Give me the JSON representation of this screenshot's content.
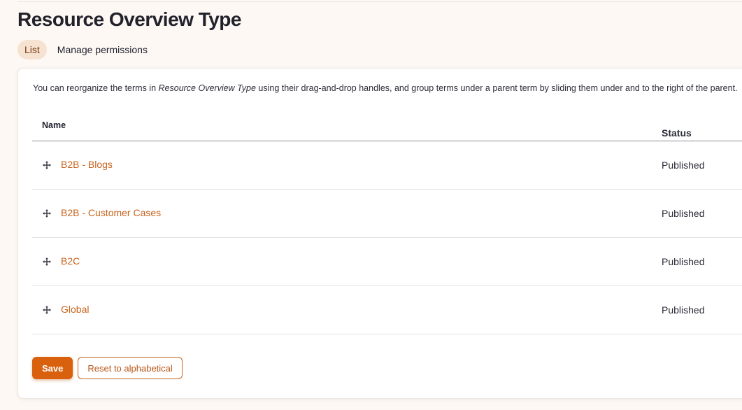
{
  "page": {
    "title": "Resource Overview Type"
  },
  "tabs": [
    {
      "label": "List",
      "active": true
    },
    {
      "label": "Manage permissions",
      "active": false
    }
  ],
  "help": {
    "prefix": "You can reorganize the terms in ",
    "vocabulary": "Resource Overview Type",
    "suffix": " using their drag-and-drop handles, and group terms under a parent term by sliding them under and to the right of the parent."
  },
  "table": {
    "headers": {
      "name": "Name",
      "status": "Status"
    },
    "rows": [
      {
        "name": "B2B - Blogs",
        "status": "Published"
      },
      {
        "name": "B2B - Customer Cases",
        "status": "Published"
      },
      {
        "name": "B2C",
        "status": "Published"
      },
      {
        "name": "Global",
        "status": "Published"
      }
    ]
  },
  "actions": {
    "save_label": "Save",
    "reset_label": "Reset to alphabetical"
  },
  "icons": {
    "drag_handle": "move-arrows-icon"
  },
  "colors": {
    "accent": "#d9600d",
    "link": "#c8631c",
    "active_tab_bg": "#f6e2d1",
    "page_bg": "#fdf8f4"
  }
}
